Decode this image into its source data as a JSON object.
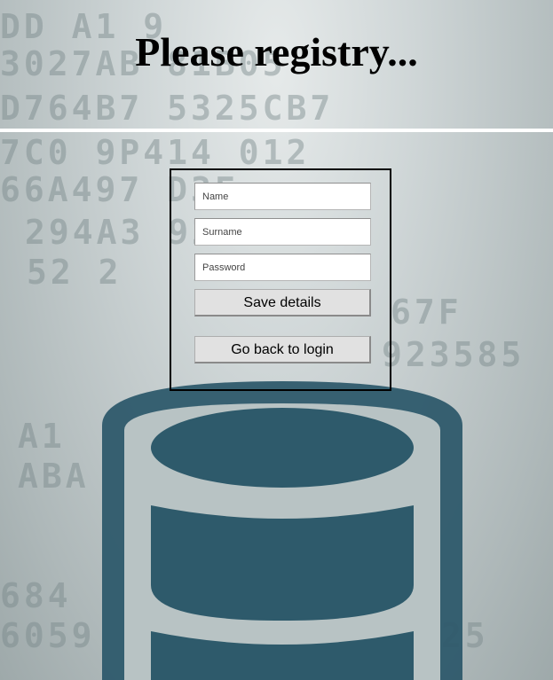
{
  "header": {
    "title": "Please registry..."
  },
  "form": {
    "name": {
      "placeholder": "Name",
      "value": ""
    },
    "surname": {
      "placeholder": "Surname",
      "value": ""
    },
    "password": {
      "placeholder": "Password",
      "value": ""
    },
    "save_label": "Save details",
    "back_label": "Go back to login"
  },
  "colors": {
    "database_icon": "#2e5a6b",
    "background": "#b9c3c4",
    "divider": "#ffffff"
  },
  "icons": {
    "background_illustration": "database-icon"
  }
}
